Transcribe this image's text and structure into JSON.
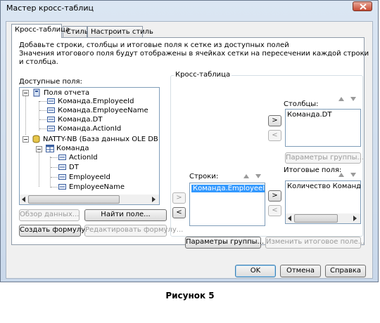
{
  "window": {
    "title": "Мастер кросс-таблиц"
  },
  "tabs": [
    {
      "label": "Кросс-таблица"
    },
    {
      "label": "Стиль"
    },
    {
      "label": "Настроить стиль"
    }
  ],
  "description": {
    "line1": "Добавьте строки, столбцы и итоговые поля к сетке из доступных полей",
    "line2": "Значения итогового поля будут отображены в ячейках сетки на пересечении каждой строки",
    "line3": "и столбца."
  },
  "available": {
    "label": "Доступные поля:",
    "tree": {
      "report_fields": "Поля отчета",
      "report_items": [
        "Команда.EmployeeId",
        "Команда.EmployeeName",
        "Команда.DT",
        "Команда.ActionId"
      ],
      "db": "NATTY-NB (База данных OLE DB (ADO))",
      "table": "Команда",
      "table_items": [
        "ActionId",
        "DT",
        "EmployeeId",
        "EmployeeName"
      ]
    }
  },
  "crosstab": {
    "label": "Кросс-таблица",
    "columns_label": "Столбцы:",
    "columns_items": [
      "Команда.DT"
    ],
    "rows_label": "Строки:",
    "rows_items": [
      "Команда.EmployeeId"
    ],
    "summary_label": "Итоговые поля:",
    "summary_items": [
      "Количество Команда.Acti"
    ],
    "group_params_button": "Параметры группы...",
    "group_params_button_disabled": "Параметры группы...",
    "change_summary_button": "Изменить итоговое поле..."
  },
  "buttons": {
    "browse": "Обзор данных...",
    "find_field": "Найти поле...",
    "create_formula": "Создать формулу...",
    "edit_formula": "Редактировать формулу...",
    "ok": "OK",
    "cancel": "Отмена",
    "help": "Справка",
    "move_right": ">",
    "move_left": "<"
  },
  "caption": "Рисунок 5"
}
